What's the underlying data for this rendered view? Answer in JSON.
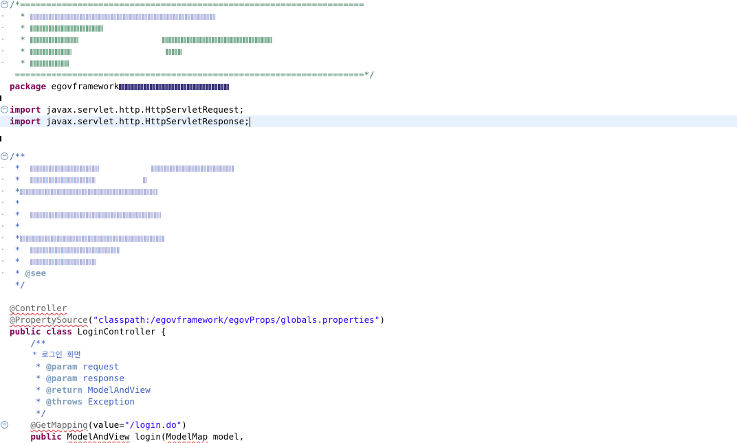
{
  "editor": {
    "header_open": "/*==================================================================",
    "header_close": " ===================================================================*/",
    "package_kw": "package",
    "package_name": "egovframework",
    "import_kw": "import",
    "import1": "javax.servlet.http.HttpServletRequest;",
    "import2": "javax.servlet.http.HttpServletResponse;",
    "doc_open": "/**",
    "doc_star": " *",
    "doc_see_star": " * ",
    "doc_see": "@see",
    "doc_close": " */",
    "ann_controller": "@Controller",
    "ann_propsource": "@PropertySource",
    "paren_open": "(",
    "paren_close": ")",
    "propsource_value": "\"classpath:/egovframework/egovProps/globals.properties\"",
    "public_kw": "public",
    "class_kw": "class",
    "class_name": " LoginController {",
    "method_doc_open": "    /**",
    "method_doc_title": "     * 로그인 화면",
    "method_star": "     * ",
    "tag_param": "@param",
    "param_request": " request",
    "param_response": " response",
    "tag_return": "@return",
    "return_value": " ModelAndView",
    "tag_throws": "@throws",
    "throws_value": " Exception",
    "method_doc_close": "     */",
    "ann_getmapping": "@GetMapping",
    "getmapping_attr": "(value=",
    "getmapping_value": "\"/login.do\"",
    "method_type": "ModelAndView",
    "method_sig": " login(",
    "param_type": "ModelMap",
    "param_rest": " model,"
  },
  "colors": {
    "keyword": "#7f0055",
    "comment": "#3f5fbf",
    "string": "#2a00ff",
    "annotation": "#646464",
    "current_line": "#e8f2fe"
  },
  "icons": {
    "fold": "fold-collapse-icon"
  }
}
